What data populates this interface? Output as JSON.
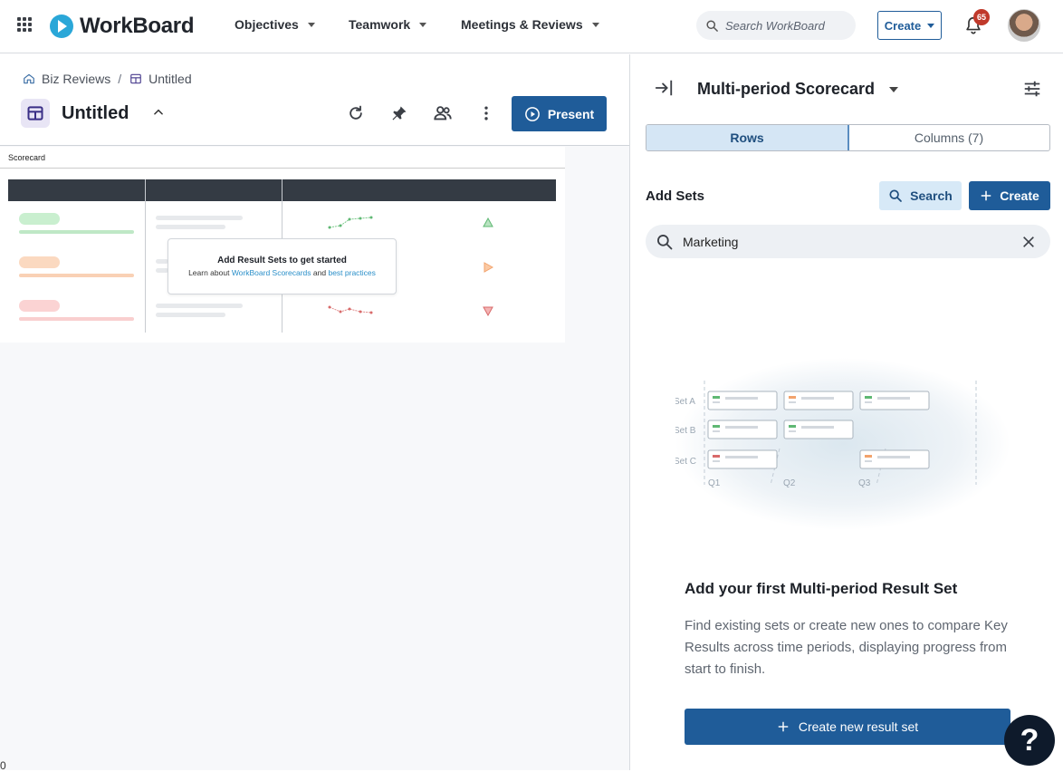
{
  "app": {
    "name": "WorkBoard"
  },
  "nav": {
    "menus": [
      "Objectives",
      "Teamwork",
      "Meetings & Reviews"
    ],
    "search_placeholder": "Search WorkBoard",
    "create_label": "Create",
    "notification_count": "65"
  },
  "breadcrumb": {
    "items": [
      "Biz Reviews",
      "Untitled"
    ],
    "separator": "/"
  },
  "page": {
    "title": "Untitled",
    "present_label": "Present"
  },
  "canvas": {
    "label": "Scorecard",
    "empty_title": "Add Result Sets to get started",
    "empty_prefix": "Learn about",
    "empty_link1": "WorkBoard Scorecards",
    "empty_and": "and",
    "empty_link2": "best practices"
  },
  "panel": {
    "title": "Multi-period Scorecard",
    "tabs": [
      "Rows",
      "Columns (7)"
    ],
    "active_tab": "Rows",
    "add_sets_label": "Add Sets",
    "search_button": "Search",
    "create_button": "Create",
    "search_value": "Marketing",
    "illustration": {
      "row_labels": [
        "Set A",
        "Set B",
        "Set C"
      ],
      "col_labels": [
        "Q1",
        "Q2",
        "Q3"
      ]
    },
    "empty_title": "Add your first Multi-period Result Set",
    "empty_desc": "Find existing sets or create new ones to compare Key Results across time periods, displaying progress from start to finish.",
    "new_set_button": "Create new result set"
  },
  "footer": {
    "zero": "0"
  },
  "help": {
    "label": "?"
  },
  "colors": {
    "primary": "#1f5c99",
    "accent": "#2aa7d8",
    "badge": "#c0392b",
    "help": "#0e1a2b"
  }
}
